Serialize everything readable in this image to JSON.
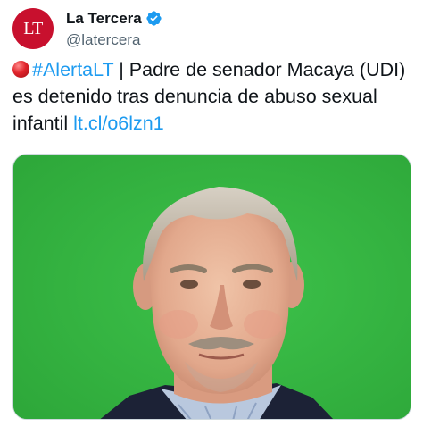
{
  "tweet": {
    "avatar_text": "LT",
    "display_name": "La Tercera",
    "handle": "@latercera",
    "hashtag": "#AlertaLT",
    "text_main": " | Padre de senador Macaya (UDI) es detenido tras denuncia de abuso sexual infantil ",
    "link": "lt.cl/o6lzn1",
    "leading_emoji": "red-circle-icon"
  },
  "colors": {
    "brand_red": "#c8102e",
    "link_blue": "#1d9bf0",
    "verified_blue": "#1d9bf0",
    "photo_background": "#35b541"
  }
}
